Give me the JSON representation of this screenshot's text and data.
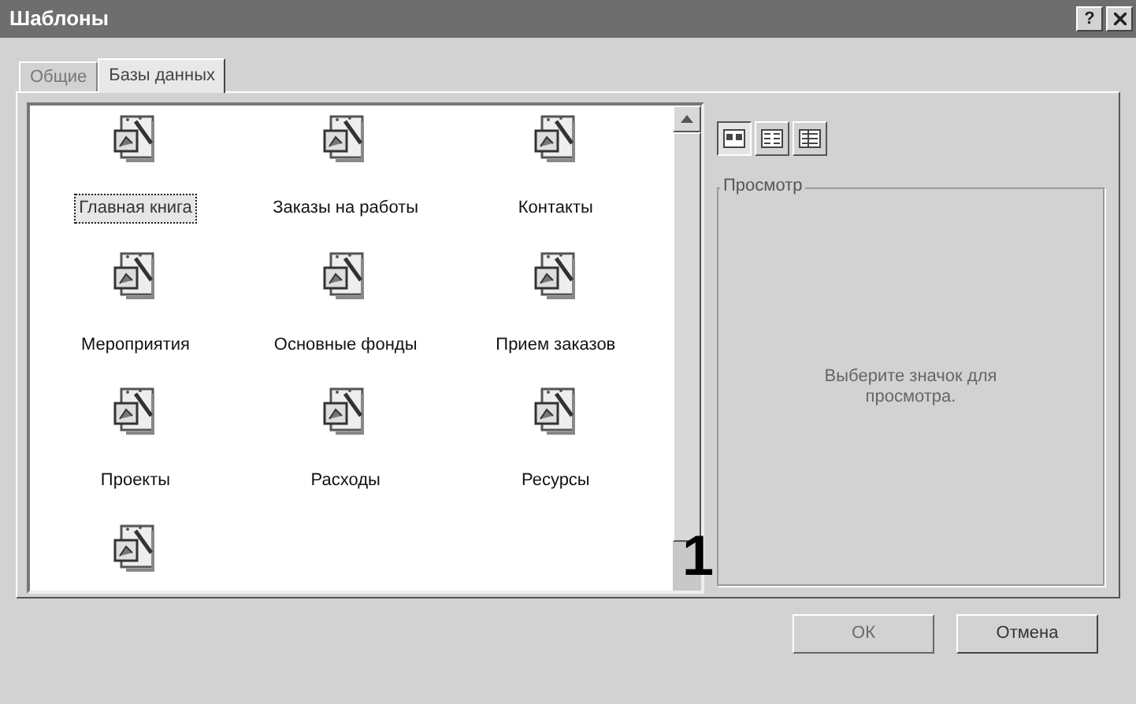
{
  "window": {
    "title": "Шаблоны",
    "controls": [
      {
        "kind": "help",
        "label": "?"
      },
      {
        "kind": "close"
      }
    ]
  },
  "tabs": [
    {
      "label": "Общие",
      "selected": false
    },
    {
      "label": "Базы данных",
      "selected": true
    }
  ],
  "templates": [
    {
      "kind": "labeled",
      "label": "Главная книга",
      "selected": true
    },
    {
      "kind": "labeled",
      "label": "Заказы на работы",
      "selected": false
    },
    {
      "kind": "labeled",
      "label": "Контакты",
      "selected": false
    },
    {
      "kind": "labeled",
      "label": "Мероприятия",
      "selected": false
    },
    {
      "kind": "labeled",
      "label": "Основные фонды",
      "selected": false
    },
    {
      "kind": "labeled",
      "label": "Прием заказов",
      "selected": false
    },
    {
      "kind": "labeled",
      "label": "Проекты",
      "selected": false
    },
    {
      "kind": "labeled",
      "label": "Расходы",
      "selected": false
    },
    {
      "kind": "labeled",
      "label": "Ресурсы",
      "selected": false
    },
    {
      "kind": "cut-off"
    }
  ],
  "view_buttons": [
    {
      "kind": "large-icons",
      "selected": true
    },
    {
      "kind": "list",
      "selected": false
    },
    {
      "kind": "details",
      "selected": false
    }
  ],
  "preview": {
    "title": "Просмотр",
    "message": "Выберите значок для просмотра."
  },
  "callout": "1",
  "buttons": [
    {
      "label": "ОК",
      "disabled": true
    },
    {
      "label": "Отмена",
      "disabled": false
    }
  ]
}
